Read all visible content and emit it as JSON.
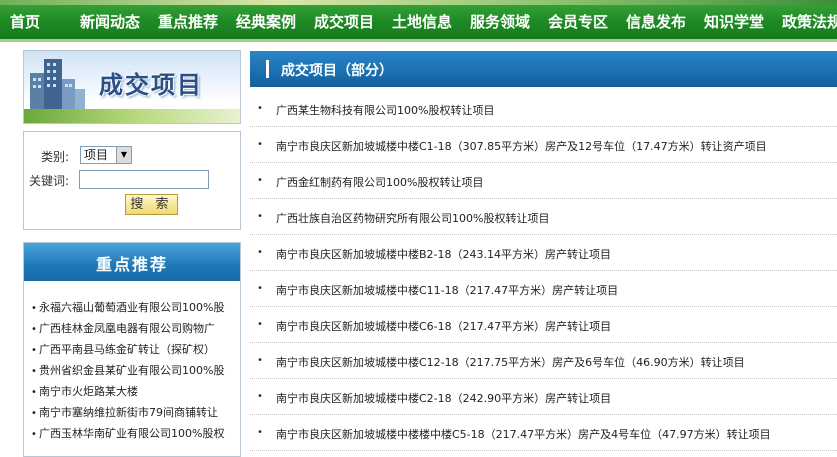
{
  "nav": {
    "items": [
      "首页",
      "新闻动态",
      "重点推荐",
      "经典案例",
      "成交项目",
      "土地信息",
      "服务领域",
      "会员专区",
      "信息发布",
      "知识学堂",
      "政策法规"
    ]
  },
  "banner": {
    "title": "成交项目"
  },
  "search": {
    "category_label": "类别:",
    "category_value": "项目",
    "keyword_label": "关键词:",
    "keyword_value": "",
    "button_label": "搜 索"
  },
  "recommend": {
    "title": "重点推荐",
    "items": [
      "永福六福山葡萄酒业有限公司100%股",
      "广西桂林金凤凰电器有限公司购物广",
      "广西平南县马练金矿转让（探矿权）",
      "贵州省织金县某矿业有限公司100%股",
      "南宁市火炬路某大楼",
      "南宁市塞纳维拉新街市79间商铺转让",
      "广西玉林华南矿业有限公司100%股权"
    ]
  },
  "main": {
    "title": "成交项目（部分）",
    "items": [
      "广西某生物科技有限公司100%股权转让项目",
      "南宁市良庆区新加坡城楼中楼C1-18（307.85平方米）房产及12号车位（17.47方米）转让资产项目",
      "广西金红制药有限公司100%股权转让项目",
      "广西壮族自治区药物研究所有限公司100%股权转让项目",
      "南宁市良庆区新加坡城楼中楼B2-18（243.14平方米）房产转让项目",
      "南宁市良庆区新加坡城楼中楼C11-18（217.47平方米）房产转让项目",
      "南宁市良庆区新加坡城楼中楼C6-18（217.47平方米）房产转让项目",
      "南宁市良庆区新加坡城楼中楼C12-18（217.75平方米）房产及6号车位（46.90方米）转让项目",
      "南宁市良庆区新加坡城楼中楼C2-18（242.90平方米）房产转让项目",
      "南宁市良庆区新加坡城楼中楼楼中楼C5-18（217.47平方米）房产及4号车位（47.97方米）转让项目"
    ]
  },
  "colors": {
    "nav_green": "#1f8a25",
    "header_blue": "#1a6fb0",
    "banner_text": "#2a4e86"
  }
}
